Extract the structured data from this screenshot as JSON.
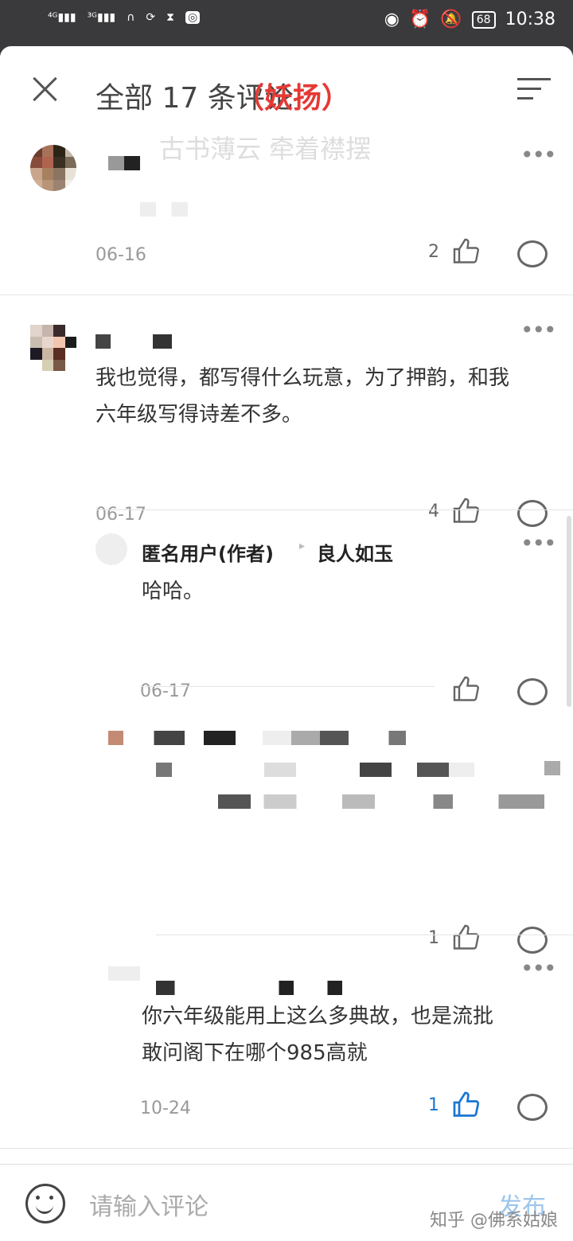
{
  "status_bar": {
    "left_text": "4G 3G",
    "time": "10:38",
    "battery": "68",
    "icons": [
      "signal-icon",
      "wifi-icon",
      "headset-icon",
      "sync-icon",
      "hourglass-icon",
      "app-icon"
    ],
    "right_icons": [
      "eye-icon",
      "alarm-icon",
      "mute-icon",
      "battery-icon"
    ]
  },
  "header": {
    "title": "全部 17 条评论",
    "title_overlay": "（妖扬）",
    "subtitle": "古书薄云 牵着襟摆",
    "close_icon": "close-icon",
    "sort_icon": "sort-icon"
  },
  "comments": [
    {
      "name": "",
      "text": "",
      "date": "06-16",
      "likes": "2"
    },
    {
      "name": "",
      "text_line1": "我也觉得，都写得什么玩意，为了押韵，和我",
      "text_line2": "六年级写得诗差不多。",
      "date": "06-17",
      "likes": "4"
    },
    {
      "name": "匿名用户(作者)",
      "reply_to": "良人如玉",
      "text": "哈哈。",
      "date": "06-17",
      "likes": ""
    },
    {
      "name": "",
      "text": "",
      "date": "",
      "likes": "1"
    },
    {
      "name": "",
      "text_line1": "你六年级能用上这么多典故，也是流批",
      "text_line2": "敢问阁下在哪个985高就",
      "date": "10-24",
      "likes": "1"
    }
  ],
  "input_bar": {
    "placeholder": "请输入评论",
    "publish": "发布",
    "watermark": "知乎 @佛系姑娘"
  },
  "colors": {
    "accent": "#1976d2",
    "red": "#e53935"
  }
}
